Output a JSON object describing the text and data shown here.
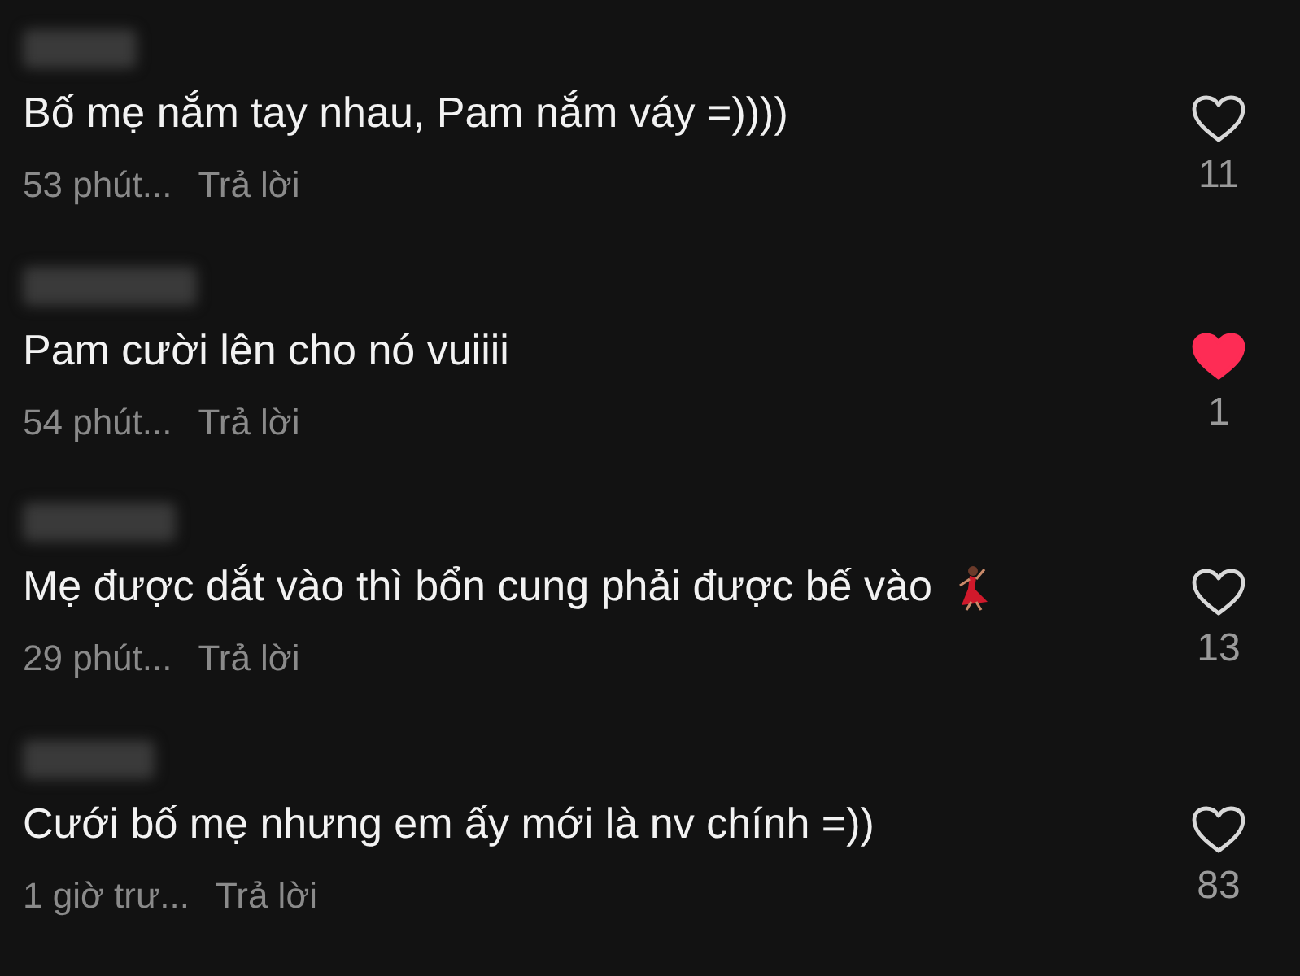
{
  "comments": [
    {
      "kind": "plain",
      "text": "Bố mẹ nắm tay nhau, Pam nắm váy =))))",
      "time": "53 phút...",
      "reply": "Trả lời",
      "liked": false,
      "likes": "11"
    },
    {
      "kind": "plain",
      "text": "Pam cười lên cho nó vuiiii",
      "time": "54 phút...",
      "reply": "Trả lời",
      "liked": true,
      "likes": "1"
    },
    {
      "kind": "emoji",
      "text": "Mẹ được dắt vào thì bổn cung phải được bế vào",
      "time": "29 phút...",
      "reply": "Trả lời",
      "liked": false,
      "likes": "13"
    },
    {
      "kind": "plain",
      "text": "Cưới bố mẹ nhưng em ấy mới là nv chính =))",
      "time": "1 giờ trư...",
      "reply": "Trả lời",
      "liked": false,
      "likes": "83"
    }
  ]
}
